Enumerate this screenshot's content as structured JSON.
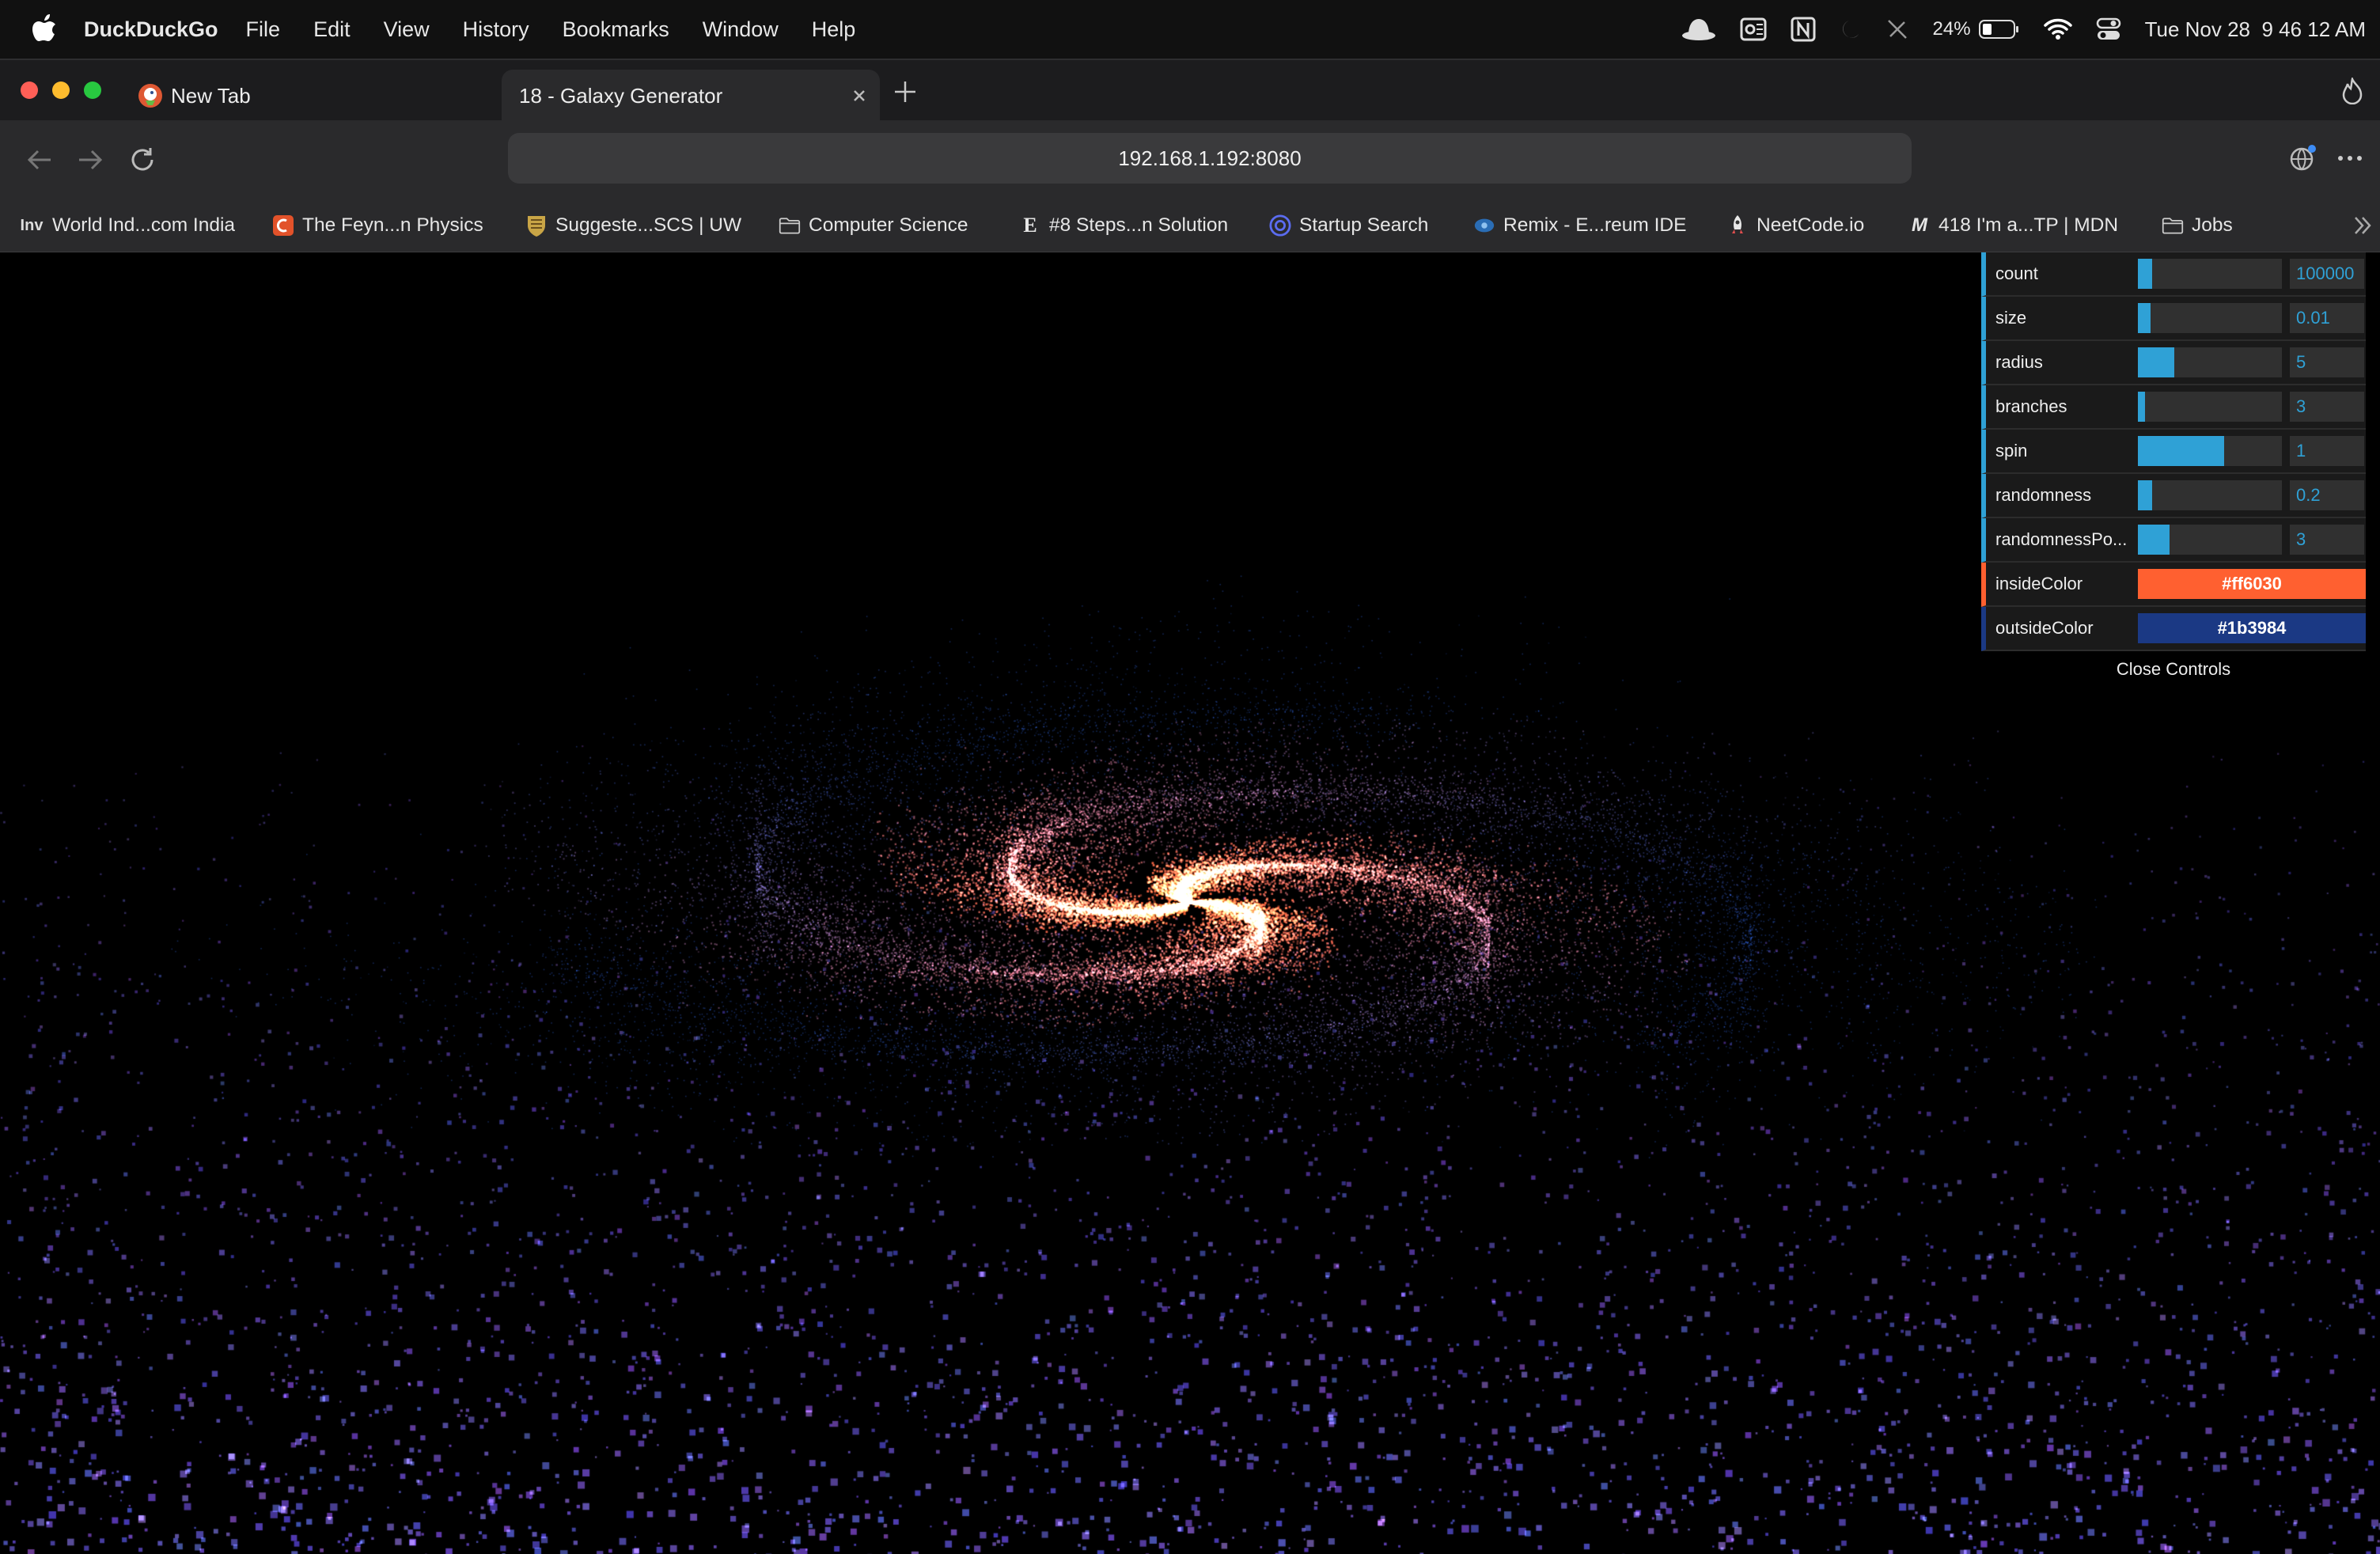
{
  "menubar": {
    "app_name": "DuckDuckGo",
    "menus": [
      "File",
      "Edit",
      "View",
      "History",
      "Bookmarks",
      "Window",
      "Help"
    ],
    "status": {
      "battery": "24%",
      "datetime": "Tue Nov 28  9 46 12 AM"
    }
  },
  "tabs": [
    {
      "label": "New Tab",
      "active": false
    },
    {
      "label": "18 - Galaxy Generator",
      "active": true
    }
  ],
  "address": {
    "url": "192.168.1.192:8080"
  },
  "bookmarks": [
    {
      "label": "World Ind...com India",
      "icon": "inv-icon"
    },
    {
      "label": "The Feyn...n Physics",
      "icon": "feynman-icon"
    },
    {
      "label": "Suggeste...SCS | UW",
      "icon": "shield-icon"
    },
    {
      "label": "Computer Science",
      "icon": "folder-icon"
    },
    {
      "label": "#8 Steps...n Solution",
      "icon": "e-icon"
    },
    {
      "label": "Startup Search",
      "icon": "search-icon"
    },
    {
      "label": "Remix - E...reum IDE",
      "icon": "remix-icon"
    },
    {
      "label": "NeetCode.io",
      "icon": "rocket-icon"
    },
    {
      "label": "418 I'm a...TP | MDN",
      "icon": "mdn-icon"
    },
    {
      "label": "Jobs",
      "icon": "folder-icon"
    }
  ],
  "controls": {
    "sliders": [
      {
        "label": "count",
        "value": "100000",
        "fraction": 0.1
      },
      {
        "label": "size",
        "value": "0.01",
        "fraction": 0.09
      },
      {
        "label": "radius",
        "value": "5",
        "fraction": 0.25
      },
      {
        "label": "branches",
        "value": "3",
        "fraction": 0.05
      },
      {
        "label": "spin",
        "value": "1",
        "fraction": 0.6
      },
      {
        "label": "randomness",
        "value": "0.2",
        "fraction": 0.1
      },
      {
        "label": "randomnessPo...",
        "value": "3",
        "fraction": 0.22
      }
    ],
    "colors": [
      {
        "label": "insideColor",
        "value": "#ff6030"
      },
      {
        "label": "outsideColor",
        "value": "#1b3984"
      }
    ],
    "close_label": "Close Controls"
  },
  "theme": {
    "accent": "#2fa1d6",
    "inside_color": "#ff6030",
    "outside_color": "#1b3984"
  }
}
